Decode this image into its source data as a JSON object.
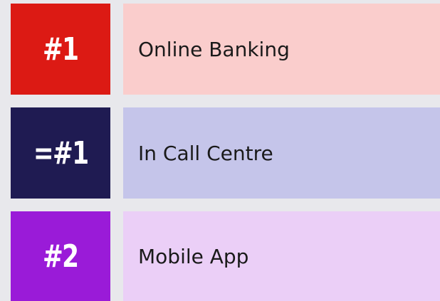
{
  "rows": [
    {
      "rank": "#1",
      "label": "Online Banking",
      "rank_color": "#dc1a14",
      "label_bg": "#facdcc"
    },
    {
      "rank": "=#1",
      "label": "In Call Centre",
      "rank_color": "#1f1b52",
      "label_bg": "#c5c5ea"
    },
    {
      "rank": "#2",
      "label": "Mobile App",
      "rank_color": "#9a1bd8",
      "label_bg": "#ebcff7"
    }
  ]
}
